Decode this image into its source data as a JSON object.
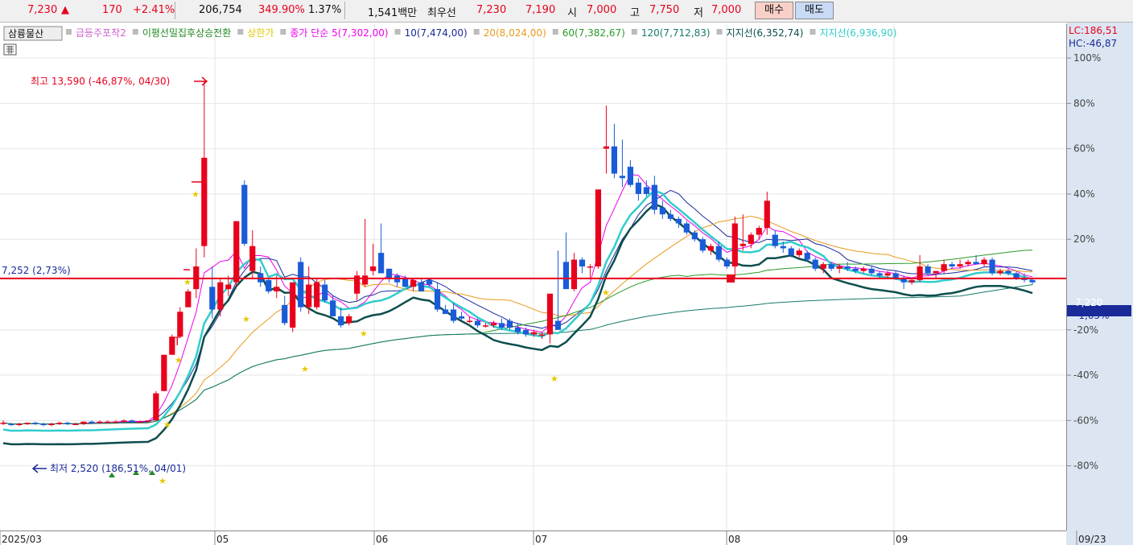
{
  "quote": {
    "price": "7,230",
    "change_arrow": "▲",
    "change": "170",
    "change_pct": "+2.41%",
    "volume": "206,754",
    "volume_ratio": "349.90%",
    "turnover": "1.37%",
    "amount": "1,541백만",
    "priority_label": "최우선",
    "ask": "7,230",
    "bid": "7,190",
    "open_label": "시",
    "open": "7,000",
    "high_label": "고",
    "high": "7,750",
    "low_label": "저",
    "low": "7,000",
    "buy_label": "매수",
    "sell_label": "매도"
  },
  "legend": {
    "stock_name": "삼륭물산",
    "items": [
      {
        "label": "급등주포착2",
        "color": "#cc66cc"
      },
      {
        "label": "이평선밀집후상승전환",
        "color": "#228822"
      },
      {
        "label": "상한가",
        "color": "#e6c800"
      },
      {
        "label": "종가 단순 5(7,302,00)",
        "color": "#ee00ee"
      },
      {
        "label": "10(7,474,00)",
        "color": "#1a2a99"
      },
      {
        "label": "20(8,024,00)",
        "color": "#e89a1c"
      },
      {
        "label": "60(7,382,67)",
        "color": "#2a9a2a"
      },
      {
        "label": "120(7,712,83)",
        "color": "#177a6a"
      },
      {
        "label": "지지선(6,352,74)",
        "color": "#0d4d4d"
      },
      {
        "label": "지지선(6,936,90)",
        "color": "#33cccc"
      }
    ]
  },
  "right_info": {
    "lc": "LC:186,51",
    "hc": "HC:-46,87"
  },
  "annotations": {
    "high": "최고 13,590 (-46,87%, 04/30)",
    "low": "최저 2,520 (186,51%, 04/01)",
    "ref_line": "7,252 (2,73%)",
    "current_price": "7,220",
    "current_pct": "-1,63%",
    "marker_t": "T"
  },
  "colors": {
    "up": "#e8001c",
    "down": "#1a5cd8",
    "ref_line": "#e8001c",
    "axis_bg": "#dce6f2"
  },
  "chart_data": {
    "type": "candlestick",
    "y_unit": "%",
    "ylim": [
      -85,
      103
    ],
    "y_ticks": [
      "100%",
      "80%",
      "60%",
      "40%",
      "20%",
      "-20%",
      "-40%",
      "-60%",
      "-80%"
    ],
    "x_ticks": [
      "2025/03",
      "05",
      "06",
      "07",
      "08",
      "09",
      "09/23"
    ],
    "ref_value_pct": 2.7,
    "candles": [
      {
        "o": -61,
        "h": -60,
        "l": -62,
        "c": -61
      },
      {
        "o": -61.5,
        "h": -61,
        "l": -62.5,
        "c": -62
      },
      {
        "o": -62,
        "h": -61,
        "l": -62.5,
        "c": -61.5
      },
      {
        "o": -61.5,
        "h": -61,
        "l": -62,
        "c": -61
      },
      {
        "o": -61,
        "h": -60.5,
        "l": -62,
        "c": -61.5
      },
      {
        "o": -61.5,
        "h": -61,
        "l": -62.5,
        "c": -62
      },
      {
        "o": -62,
        "h": -61,
        "l": -62.5,
        "c": -61.5
      },
      {
        "o": -61.5,
        "h": -60.5,
        "l": -62,
        "c": -61
      },
      {
        "o": -61,
        "h": -60.5,
        "l": -62,
        "c": -61.5
      },
      {
        "o": -61.5,
        "h": -61,
        "l": -62,
        "c": -61.5
      },
      {
        "o": -61.5,
        "h": -60.5,
        "l": -62,
        "c": -60.5
      },
      {
        "o": -60.5,
        "h": -60,
        "l": -61.5,
        "c": -61
      },
      {
        "o": -61,
        "h": -60,
        "l": -61.5,
        "c": -60.5
      },
      {
        "o": -60.5,
        "h": -60,
        "l": -61,
        "c": -60.5
      },
      {
        "o": -60.5,
        "h": -60,
        "l": -61,
        "c": -60.5
      },
      {
        "o": -60.5,
        "h": -59.5,
        "l": -61,
        "c": -60
      },
      {
        "o": -60,
        "h": -59.5,
        "l": -61,
        "c": -60.5
      },
      {
        "o": -60.5,
        "h": -60,
        "l": -61,
        "c": -60.5
      },
      {
        "o": -60.5,
        "h": -60,
        "l": -61,
        "c": -60
      },
      {
        "o": -60,
        "h": -47,
        "l": -60,
        "c": -48
      },
      {
        "o": -47,
        "h": -31,
        "l": -47,
        "c": -31
      },
      {
        "o": -31,
        "h": -22,
        "l": -31,
        "c": -23
      },
      {
        "o": -23,
        "h": -10,
        "l": -23,
        "c": -12
      },
      {
        "o": -10,
        "h": -2,
        "l": -10,
        "c": -3
      },
      {
        "o": -2,
        "h": 16,
        "l": -6,
        "c": 8
      },
      {
        "o": 17,
        "h": 90,
        "l": 12,
        "c": 56
      },
      {
        "o": -1,
        "h": 8,
        "l": -15,
        "c": -11
      },
      {
        "o": -11,
        "h": 3,
        "l": -14,
        "c": 1
      },
      {
        "o": -2,
        "h": 4,
        "l": -5,
        "c": 0
      },
      {
        "o": 1,
        "h": 18,
        "l": -1,
        "c": 28
      },
      {
        "o": 44,
        "h": 46,
        "l": 17,
        "c": 18
      },
      {
        "o": 6,
        "h": 24,
        "l": 3,
        "c": 17
      },
      {
        "o": 5,
        "h": 8,
        "l": -1,
        "c": 1
      },
      {
        "o": 2,
        "h": 3,
        "l": -4,
        "c": -3
      },
      {
        "o": -3,
        "h": 4,
        "l": -6,
        "c": -1
      },
      {
        "o": -9,
        "h": -5,
        "l": -18,
        "c": -17
      },
      {
        "o": -19,
        "h": 1,
        "l": -21,
        "c": 1
      },
      {
        "o": 10,
        "h": 12,
        "l": -12,
        "c": -10
      },
      {
        "o": -10,
        "h": 8,
        "l": -13,
        "c": 0
      },
      {
        "o": -10,
        "h": 3,
        "l": -11,
        "c": 1
      },
      {
        "o": 0,
        "h": 2,
        "l": -8,
        "c": -7
      },
      {
        "o": -7,
        "h": -5,
        "l": -14,
        "c": -14
      },
      {
        "o": -14,
        "h": -10,
        "l": -19,
        "c": -18
      },
      {
        "o": -17,
        "h": -13,
        "l": -18,
        "c": -14
      },
      {
        "o": -4,
        "h": 6,
        "l": -7,
        "c": 4
      },
      {
        "o": 0,
        "h": 29,
        "l": -1,
        "c": 4
      },
      {
        "o": 6,
        "h": 18,
        "l": 4,
        "c": 8
      },
      {
        "o": 14,
        "h": 27,
        "l": 8,
        "c": 5
      },
      {
        "o": 7,
        "h": 7,
        "l": 1,
        "c": 3
      },
      {
        "o": 4,
        "h": 5,
        "l": -1,
        "c": 1
      },
      {
        "o": 3,
        "h": 4,
        "l": -1,
        "c": -1
      },
      {
        "o": -1,
        "h": 3,
        "l": -3,
        "c": 2
      },
      {
        "o": 1,
        "h": 3,
        "l": -2,
        "c": -3
      },
      {
        "o": 2,
        "h": 3,
        "l": -1,
        "c": 0
      },
      {
        "o": -2,
        "h": 1,
        "l": -12,
        "c": -11
      },
      {
        "o": -11,
        "h": -9,
        "l": -13,
        "c": -13
      },
      {
        "o": -11,
        "h": -8,
        "l": -17,
        "c": -16
      },
      {
        "o": -14,
        "h": -12,
        "l": -16,
        "c": -15
      },
      {
        "o": -16,
        "h": -14,
        "l": -17,
        "c": -16
      },
      {
        "o": -16,
        "h": -15,
        "l": -19,
        "c": -18
      },
      {
        "o": -18,
        "h": -17,
        "l": -19,
        "c": -18
      },
      {
        "o": -18,
        "h": -16,
        "l": -19,
        "c": -17
      },
      {
        "o": -17,
        "h": -15,
        "l": -20,
        "c": -19
      },
      {
        "o": -16,
        "h": -15,
        "l": -20,
        "c": -19
      },
      {
        "o": -19,
        "h": -17,
        "l": -22,
        "c": -21
      },
      {
        "o": -20,
        "h": -19,
        "l": -23,
        "c": -22
      },
      {
        "o": -22,
        "h": -20,
        "l": -23,
        "c": -21
      },
      {
        "o": -22,
        "h": -21,
        "l": -24,
        "c": -22
      },
      {
        "o": -22,
        "h": -4,
        "l": -26,
        "c": -4
      },
      {
        "o": -16,
        "h": 15,
        "l": -17,
        "c": -20
      },
      {
        "o": 10,
        "h": 23,
        "l": 8,
        "c": -2
      },
      {
        "o": -2,
        "h": 14,
        "l": -3,
        "c": 11
      },
      {
        "o": 11,
        "h": 12,
        "l": 5,
        "c": 8
      },
      {
        "o": 8,
        "h": 9,
        "l": 3,
        "c": 8
      },
      {
        "o": 8,
        "h": 37,
        "l": 7,
        "c": 42
      },
      {
        "o": 60,
        "h": 79,
        "l": 49,
        "c": 61
      },
      {
        "o": 61,
        "h": 71,
        "l": 47,
        "c": 49
      },
      {
        "o": 48,
        "h": 64,
        "l": 43,
        "c": 47
      },
      {
        "o": 52,
        "h": 55,
        "l": 43,
        "c": 44
      },
      {
        "o": 45,
        "h": 47,
        "l": 37,
        "c": 40
      },
      {
        "o": 43,
        "h": 46,
        "l": 39,
        "c": 40
      },
      {
        "o": 44,
        "h": 48,
        "l": 31,
        "c": 33
      },
      {
        "o": 34,
        "h": 37,
        "l": 29,
        "c": 31
      },
      {
        "o": 31,
        "h": 33,
        "l": 28,
        "c": 29
      },
      {
        "o": 29,
        "h": 30,
        "l": 25,
        "c": 27
      },
      {
        "o": 27,
        "h": 28,
        "l": 22,
        "c": 23
      },
      {
        "o": 23,
        "h": 24,
        "l": 19,
        "c": 20
      },
      {
        "o": 20,
        "h": 21,
        "l": 14,
        "c": 15
      },
      {
        "o": 15,
        "h": 18,
        "l": 13,
        "c": 17
      },
      {
        "o": 17,
        "h": 19,
        "l": 10,
        "c": 11
      },
      {
        "o": 11,
        "h": 12,
        "l": 7,
        "c": 8
      },
      {
        "o": 8,
        "h": 30,
        "l": 3,
        "c": 27
      },
      {
        "o": 17,
        "h": 31,
        "l": 15,
        "c": 18
      },
      {
        "o": 18,
        "h": 23,
        "l": 16,
        "c": 22
      },
      {
        "o": 22,
        "h": 26,
        "l": 20,
        "c": 25
      },
      {
        "o": 25,
        "h": 41,
        "l": 22,
        "c": 37
      },
      {
        "o": 22,
        "h": 24,
        "l": 16,
        "c": 17
      },
      {
        "o": 17,
        "h": 19,
        "l": 14,
        "c": 16
      },
      {
        "o": 16,
        "h": 17,
        "l": 12,
        "c": 13
      },
      {
        "o": 13,
        "h": 16,
        "l": 12,
        "c": 15
      },
      {
        "o": 14,
        "h": 15,
        "l": 10,
        "c": 11
      },
      {
        "o": 11,
        "h": 12,
        "l": 6,
        "c": 7
      },
      {
        "o": 7,
        "h": 10,
        "l": 5,
        "c": 9
      },
      {
        "o": 9,
        "h": 10,
        "l": 6,
        "c": 7
      },
      {
        "o": 7,
        "h": 9,
        "l": 5,
        "c": 8
      },
      {
        "o": 8,
        "h": 10,
        "l": 6,
        "c": 7
      },
      {
        "o": 7,
        "h": 8,
        "l": 5,
        "c": 6
      },
      {
        "o": 6,
        "h": 8,
        "l": 5,
        "c": 7
      },
      {
        "o": 7,
        "h": 8,
        "l": 4,
        "c": 5
      },
      {
        "o": 5,
        "h": 6,
        "l": 3,
        "c": 4
      },
      {
        "o": 4,
        "h": 6,
        "l": 3,
        "c": 5
      },
      {
        "o": 5,
        "h": 6,
        "l": 2,
        "c": 3
      },
      {
        "o": 3,
        "h": 4,
        "l": -2,
        "c": 1
      },
      {
        "o": 1,
        "h": 3,
        "l": 0,
        "c": 2
      },
      {
        "o": 2,
        "h": 13,
        "l": 1,
        "c": 8
      },
      {
        "o": 8,
        "h": 9,
        "l": 4,
        "c": 5
      },
      {
        "o": 5,
        "h": 6,
        "l": 3,
        "c": 6
      },
      {
        "o": 6,
        "h": 11,
        "l": 5,
        "c": 9
      },
      {
        "o": 9,
        "h": 10,
        "l": 7,
        "c": 8
      },
      {
        "o": 8,
        "h": 11,
        "l": 7,
        "c": 9
      },
      {
        "o": 9,
        "h": 11,
        "l": 8,
        "c": 10
      },
      {
        "o": 10,
        "h": 13,
        "l": 9,
        "c": 9
      },
      {
        "o": 9,
        "h": 12,
        "l": 8,
        "c": 11
      },
      {
        "o": 11,
        "h": 12,
        "l": 4,
        "c": 5
      },
      {
        "o": 5,
        "h": 7,
        "l": 4,
        "c": 6
      },
      {
        "o": 6,
        "h": 7,
        "l": 4,
        "c": 5
      },
      {
        "o": 5,
        "h": 6,
        "l": 2,
        "c": 3
      },
      {
        "o": 3,
        "h": 5,
        "l": 1,
        "c": 2
      },
      {
        "o": 2,
        "h": 3,
        "l": 0,
        "c": 1
      }
    ]
  }
}
